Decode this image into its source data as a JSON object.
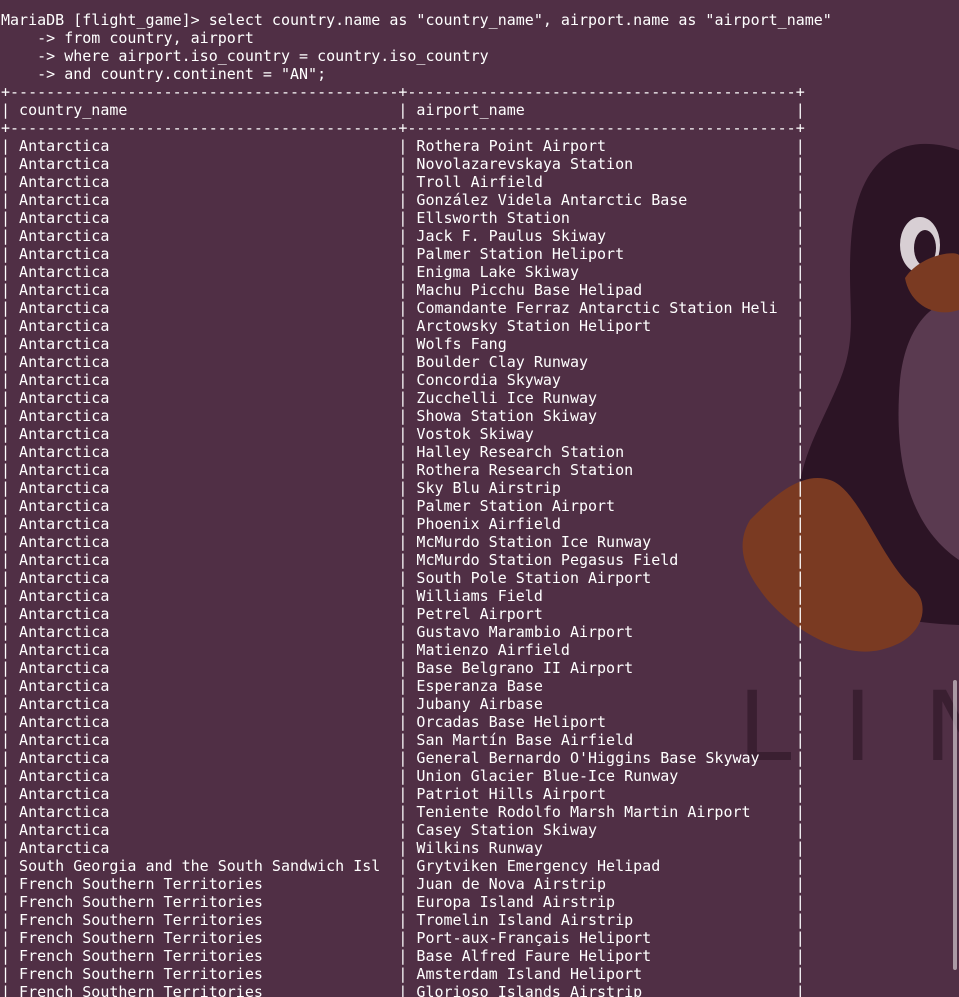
{
  "terminal": {
    "prompt": "MariaDB [flight_game]> ",
    "query_lines": [
      "select country.name as \"country_name\", airport.name as \"airport_name\"",
      "    -> from country, airport",
      "    -> where airport.iso_country = country.iso_country",
      "    -> and country.continent = \"AN\";"
    ],
    "border_line": "+-------------------------------------------+-------------------------------------------+",
    "columns": [
      "country_name",
      "airport_name"
    ],
    "col_widths": [
      42,
      42
    ],
    "rows": [
      [
        "Antarctica",
        "Rothera Point Airport"
      ],
      [
        "Antarctica",
        "Novolazarevskaya Station"
      ],
      [
        "Antarctica",
        "Troll Airfield"
      ],
      [
        "Antarctica",
        "González Videla Antarctic Base"
      ],
      [
        "Antarctica",
        "Ellsworth Station"
      ],
      [
        "Antarctica",
        "Jack F. Paulus Skiway"
      ],
      [
        "Antarctica",
        "Palmer Station Heliport"
      ],
      [
        "Antarctica",
        "Enigma Lake Skiway"
      ],
      [
        "Antarctica",
        "Machu Picchu Base Helipad"
      ],
      [
        "Antarctica",
        "Comandante Ferraz Antarctic Station Heli"
      ],
      [
        "Antarctica",
        "Arctowsky Station Heliport"
      ],
      [
        "Antarctica",
        "Wolfs Fang"
      ],
      [
        "Antarctica",
        "Boulder Clay Runway"
      ],
      [
        "Antarctica",
        "Concordia Skyway"
      ],
      [
        "Antarctica",
        "Zucchelli Ice Runway"
      ],
      [
        "Antarctica",
        "Showa Station Skiway"
      ],
      [
        "Antarctica",
        "Vostok Skiway"
      ],
      [
        "Antarctica",
        "Halley Research Station"
      ],
      [
        "Antarctica",
        "Rothera Research Station"
      ],
      [
        "Antarctica",
        "Sky Blu Airstrip"
      ],
      [
        "Antarctica",
        "Palmer Station Airport"
      ],
      [
        "Antarctica",
        "Phoenix Airfield"
      ],
      [
        "Antarctica",
        "McMurdo Station Ice Runway"
      ],
      [
        "Antarctica",
        "McMurdo Station Pegasus Field"
      ],
      [
        "Antarctica",
        "South Pole Station Airport"
      ],
      [
        "Antarctica",
        "Williams Field"
      ],
      [
        "Antarctica",
        "Petrel Airport"
      ],
      [
        "Antarctica",
        "Gustavo Marambio Airport"
      ],
      [
        "Antarctica",
        "Matienzo Airfield"
      ],
      [
        "Antarctica",
        "Base Belgrano II Airport"
      ],
      [
        "Antarctica",
        "Esperanza Base"
      ],
      [
        "Antarctica",
        "Jubany Airbase"
      ],
      [
        "Antarctica",
        "Orcadas Base Heliport"
      ],
      [
        "Antarctica",
        "San Martín Base Airfield"
      ],
      [
        "Antarctica",
        "General Bernardo O'Higgins Base Skyway"
      ],
      [
        "Antarctica",
        "Union Glacier Blue-Ice Runway"
      ],
      [
        "Antarctica",
        "Patriot Hills Airport"
      ],
      [
        "Antarctica",
        "Teniente Rodolfo Marsh Martin Airport"
      ],
      [
        "Antarctica",
        "Casey Station Skiway"
      ],
      [
        "Antarctica",
        "Wilkins Runway"
      ],
      [
        "South Georgia and the South Sandwich Isl",
        "Grytviken Emergency Helipad"
      ],
      [
        "French Southern Territories",
        "Juan de Nova Airstrip"
      ],
      [
        "French Southern Territories",
        "Europa Island Airstrip"
      ],
      [
        "French Southern Territories",
        "Tromelin Island Airstrip"
      ],
      [
        "French Southern Territories",
        "Port-aux-Français Heliport"
      ],
      [
        "French Southern Territories",
        "Base Alfred Faure Heliport"
      ],
      [
        "French Southern Territories",
        "Amsterdam Island Heliport"
      ],
      [
        "French Southern Territories",
        "Glorioso Islands Airstrip"
      ]
    ]
  },
  "wallpaper": {
    "text": "LIN",
    "colors": {
      "background": "#502f45",
      "tux_body": "#2c1425",
      "tux_belly": "#5a3a50",
      "tux_beak": "#7a3a22",
      "text": "#ffffff"
    }
  }
}
